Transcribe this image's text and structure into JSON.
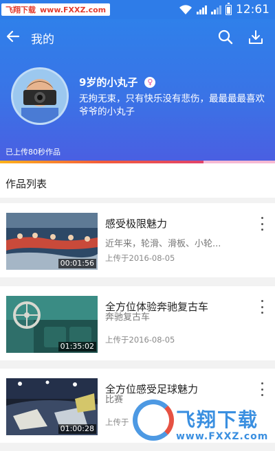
{
  "watermark": {
    "brand": "飞翔下载",
    "url": "www.FXXZ.com",
    "brand_large": "飞翔下载",
    "url_large": "www.FXXZ.com"
  },
  "status_bar": {
    "time": "12:61",
    "icons": [
      "wifi-icon",
      "signal-icon",
      "signal-icon",
      "battery-icon"
    ]
  },
  "app_bar": {
    "title": "我的",
    "icons": [
      "back-arrow-icon",
      "search-icon",
      "download-icon"
    ]
  },
  "profile": {
    "username": "9岁的小丸子",
    "gender_icon": "female-icon",
    "bio": "无拘无束，只有快乐没有悲伤，最最最最喜欢爷爷的小丸子",
    "upload_info": "已上传80秒作品",
    "upload_progress": 0.74
  },
  "works_list": {
    "title": "作品列表",
    "items": [
      {
        "title": "感受极限魅力",
        "description": "近年来，轮滑、滑板、小轮...",
        "date": "上传于2016-08-05",
        "duration": "00:01:56"
      },
      {
        "title": "全方位体验奔驰复古车",
        "description": "奔驰复古车",
        "date": "上传于2016-08-05",
        "duration": "01:35:02"
      },
      {
        "title": "全方位感受足球魅力",
        "description": "比赛",
        "date": "上传于",
        "duration": "01:00:28"
      }
    ]
  },
  "colors": {
    "primary": "#2e7ce8",
    "progress_start": "#ffb21c",
    "progress_end": "#e0436b",
    "track": "#f6b9d3"
  }
}
